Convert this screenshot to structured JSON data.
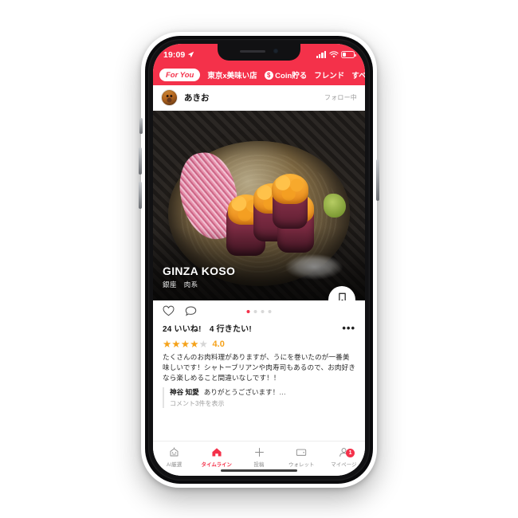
{
  "status_bar": {
    "time": "19:09",
    "location_icon": "location-arrow-icon",
    "signal_icon": "cellular-signal-icon",
    "wifi_icon": "wifi-icon",
    "battery_icon": "battery-low-icon"
  },
  "top_nav": {
    "tabs": [
      {
        "label": "For You",
        "active": true
      },
      {
        "label": "東京x美味い店",
        "active": false
      },
      {
        "label": "Coin貯る",
        "active": false,
        "icon": "coin-icon"
      },
      {
        "label": "フレンド",
        "active": false
      },
      {
        "label": "すべて",
        "active": false
      }
    ]
  },
  "post": {
    "author": "あきお",
    "follow_status": "フォロー中",
    "avatar_icon": "user-avatar",
    "venue_name": "GINZA KOSO",
    "venue_meta": "銀座　肉系",
    "bookmark_count": "4",
    "like_icon": "heart-icon",
    "comment_icon": "comment-bubble-icon",
    "bookmark_icon": "bookmark-icon",
    "more_icon": "more-options-icon",
    "carousel": {
      "total": 4,
      "current": 1
    },
    "stats": "24 いいね!　4 行きたい!",
    "rating_value": "4.0",
    "rating_stars_filled": 4,
    "rating_stars_total": 5,
    "review_text": "たくさんのお肉料理がありますが、うにを巻いたのが一番美味しいです！シャトーブリアンや肉寿司もあるので、お肉好きなら楽しめること間違いなしです！！",
    "comment": {
      "user": "神谷 知愛",
      "text": "ありがとうございます！…",
      "view_all": "コメント3件を表示"
    }
  },
  "bottom_nav": {
    "items": [
      {
        "label": "AI厳選",
        "icon": "ai-select-icon",
        "active": false,
        "badge": ""
      },
      {
        "label": "タイムライン",
        "icon": "home-icon",
        "active": true,
        "badge": ""
      },
      {
        "label": "投稿",
        "icon": "plus-icon",
        "active": false,
        "badge": ""
      },
      {
        "label": "ウォレット",
        "icon": "wallet-icon",
        "active": false,
        "badge": ""
      },
      {
        "label": "マイページ",
        "icon": "person-icon",
        "active": false,
        "badge": "1"
      }
    ]
  },
  "colors": {
    "brand_red": "#f4314a",
    "star_orange": "#f5a21a",
    "inactive_gray": "#8d8d8d"
  }
}
